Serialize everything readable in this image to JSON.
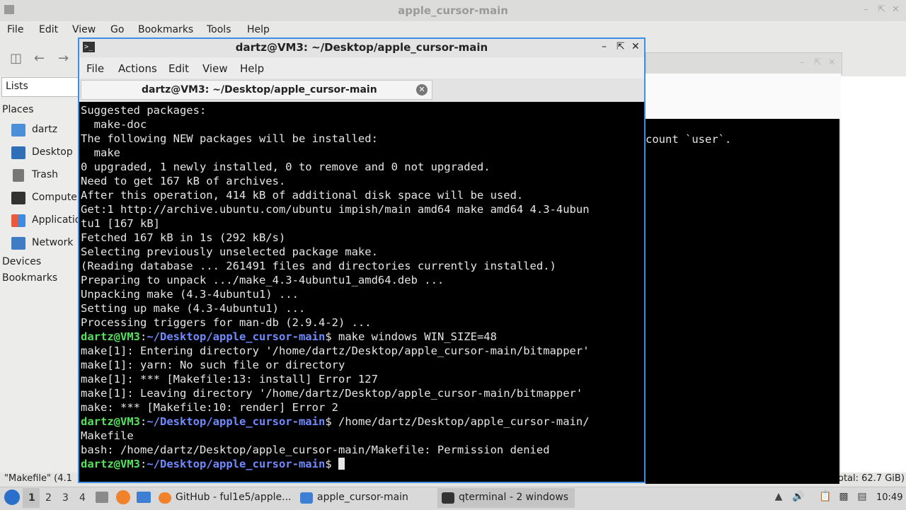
{
  "file_manager": {
    "title": "apple_cursor-main",
    "menu": [
      "File",
      "Edit",
      "View",
      "Go",
      "Bookmarks",
      "Tools",
      "Help"
    ],
    "side_tab": "Lists",
    "sections": {
      "places": "Places",
      "devices": "Devices",
      "bookmarks": "Bookmarks"
    },
    "places": [
      "dartz",
      "Desktop",
      "Trash",
      "Computer",
      "Applications",
      "Network"
    ],
    "status_left": "\"Makefile\" (4.1",
    "status_right": "otal: 62.7 GiB)"
  },
  "terminal_behind": {
    "text": "count `user`."
  },
  "terminal": {
    "title": "dartz@VM3: ~/Desktop/apple_cursor-main",
    "menu": [
      "File",
      "Actions",
      "Edit",
      "View",
      "Help"
    ],
    "tab_label": "dartz@VM3: ~/Desktop/apple_cursor-main",
    "prompt_user": "dartz@VM3",
    "prompt_path": "~/Desktop/apple_cursor-main",
    "lines": [
      {
        "text": "Suggested packages:"
      },
      {
        "text": "  make-doc"
      },
      {
        "text": "The following NEW packages will be installed:"
      },
      {
        "text": "  make"
      },
      {
        "text": "0 upgraded, 1 newly installed, 0 to remove and 0 not upgraded."
      },
      {
        "text": "Need to get 167 kB of archives."
      },
      {
        "text": "After this operation, 414 kB of additional disk space will be used."
      },
      {
        "text": "Get:1 http://archive.ubuntu.com/ubuntu impish/main amd64 make amd64 4.3-4ubun"
      },
      {
        "text": "tu1 [167 kB]"
      },
      {
        "text": "Fetched 167 kB in 1s (292 kB/s)"
      },
      {
        "text": "Selecting previously unselected package make."
      },
      {
        "text": "(Reading database ... 261491 files and directories currently installed.)"
      },
      {
        "text": "Preparing to unpack .../make_4.3-4ubuntu1_amd64.deb ..."
      },
      {
        "text": "Unpacking make (4.3-4ubuntu1) ..."
      },
      {
        "text": "Setting up make (4.3-4ubuntu1) ..."
      },
      {
        "text": "Processing triggers for man-db (2.9.4-2) ..."
      },
      {
        "prompt": true,
        "text": " make windows WIN_SIZE=48"
      },
      {
        "text": "make[1]: Entering directory '/home/dartz/Desktop/apple_cursor-main/bitmapper'"
      },
      {
        "text": "make[1]: yarn: No such file or directory"
      },
      {
        "text": "make[1]: *** [Makefile:13: install] Error 127"
      },
      {
        "text": "make[1]: Leaving directory '/home/dartz/Desktop/apple_cursor-main/bitmapper'"
      },
      {
        "text": "make: *** [Makefile:10: render] Error 2"
      },
      {
        "prompt": true,
        "text": " /home/dartz/Desktop/apple_cursor-main/"
      },
      {
        "text": "Makefile"
      },
      {
        "text": "bash: /home/dartz/Desktop/apple_cursor-main/Makefile: Permission denied"
      },
      {
        "prompt": true,
        "text": " ",
        "cursor": true
      }
    ]
  },
  "taskbar": {
    "workspaces": [
      "1",
      "2",
      "3",
      "4"
    ],
    "tasks": [
      "GitHub - ful1e5/apple...",
      "apple_cursor-main",
      "qterminal - 2 windows"
    ],
    "clock": "10:49"
  },
  "colors": {
    "prompt_user": "#55e35b",
    "prompt_path": "#6f8bff",
    "active_border": "#3c8ee6"
  }
}
